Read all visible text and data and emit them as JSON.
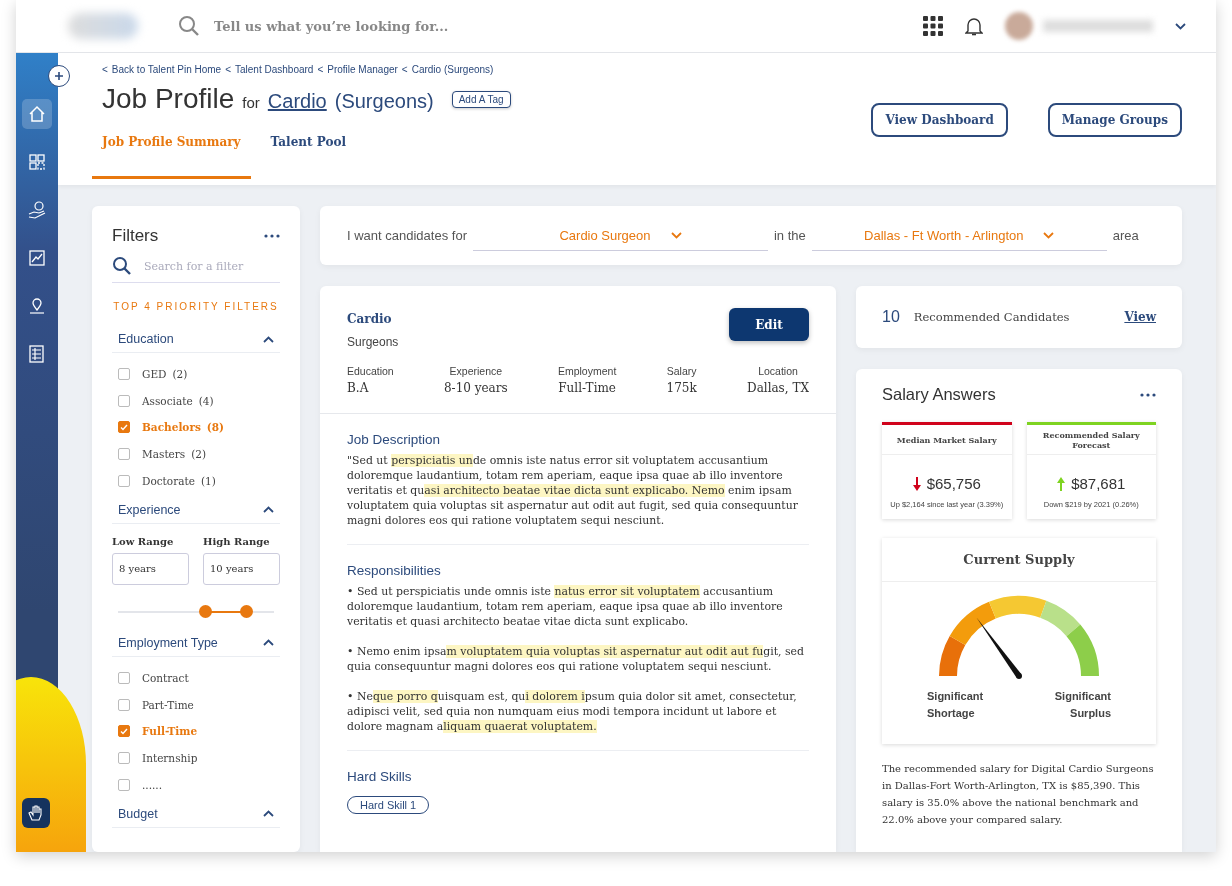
{
  "search": {
    "placeholder": "Tell us what you’re looking for..."
  },
  "sidebar": {
    "items": [
      {
        "selected": true
      },
      {
        "selected": false
      },
      {
        "selected": false
      },
      {
        "selected": false
      },
      {
        "selected": false
      },
      {
        "selected": false
      }
    ]
  },
  "breadcrumb": {
    "separator": "<",
    "items": [
      "Back to Talent Pin Home",
      "Talent Dashboard",
      "Profile Manager",
      "Cardio (Surgeons)"
    ]
  },
  "title": {
    "text": "Job Profile",
    "for": "for",
    "link": "Cardio",
    "suffix": "(Surgeons)",
    "tag_button": "Add A Tag"
  },
  "tabs": [
    {
      "label": "Job Profile Summary",
      "selected": true
    },
    {
      "label": "Talent Pool",
      "selected": false
    }
  ],
  "header_buttons": [
    "View Dashboard",
    "Manage Groups"
  ],
  "filters": {
    "title": "Filters",
    "search_placeholder": "Search for a filter",
    "priority_label": "TOP 4 PRIORITY FILTERS",
    "sections": [
      {
        "kind": "checklist",
        "title": "Education",
        "expanded": true,
        "options": [
          {
            "label": "GED",
            "count": "(2)",
            "checked": false
          },
          {
            "label": "Associate",
            "count": "(4)",
            "checked": false
          },
          {
            "label": "Bachelors",
            "count": "(8)",
            "checked": true
          },
          {
            "label": "Masters",
            "count": "(2)",
            "checked": false
          },
          {
            "label": "Doctorate",
            "count": "(1)",
            "checked": false
          }
        ]
      },
      {
        "kind": "range",
        "title": "Experience",
        "expanded": true,
        "low_label": "Low Range",
        "high_label": "High Range",
        "low_value": "8 years",
        "high_value": "10 years",
        "thumbs": [
          {
            "level": 0.56
          },
          {
            "level": 0.82
          }
        ]
      },
      {
        "kind": "checklist",
        "title": "Employment Type",
        "expanded": true,
        "options": [
          {
            "label": "Contract",
            "checked": false
          },
          {
            "label": "Part-Time",
            "checked": false
          },
          {
            "label": "Full-Time",
            "checked": true
          },
          {
            "label": "Internship",
            "checked": false
          },
          {
            "label": "......",
            "checked": false
          }
        ]
      },
      {
        "kind": "checklist",
        "title": "Budget",
        "expanded": true
      }
    ]
  },
  "query": {
    "prefix": "I want candidates for",
    "role": "Cardio Surgeon",
    "middle": "in the",
    "area": "Dallas - Ft Worth - Arlington",
    "suffix": "area"
  },
  "job": {
    "name": "Cardio",
    "subtitle": "Surgeons",
    "edit_button": "Edit",
    "stats": [
      {
        "label": "Education",
        "value": "B.A"
      },
      {
        "label": "Experience",
        "value": "8-10 years"
      },
      {
        "label": "Employment",
        "value": "Full-Time"
      },
      {
        "label": "Salary",
        "value": "175k"
      },
      {
        "label": "Location",
        "value": "Dallas, TX"
      }
    ],
    "sections": [
      {
        "kind": "text",
        "title": "Job Description",
        "paragraphs": [
          [
            {
              "text": "\"Sed ut ",
              "highlighted": false
            },
            {
              "text": "perspiciatis un",
              "highlighted": true
            },
            {
              "text": "de omnis iste natus error sit voluptatem accusantium doloremque laudantium, totam rem aperiam, eaque ipsa quae ab illo inventore veritatis et qu",
              "highlighted": false
            },
            {
              "text": "asi architecto beatae vitae dicta sunt explicabo. Nemo",
              "highlighted": true
            },
            {
              "text": " enim ipsam voluptatem quia voluptas sit aspernatur aut odit aut fugit, sed quia consequuntur magni dolores eos qui ratione voluptatem sequi nesciunt.",
              "highlighted": false
            }
          ]
        ]
      },
      {
        "kind": "text",
        "title": "Responsibilities",
        "paragraphs": [
          [
            {
              "text": "• Sed ut perspiciatis unde omnis iste ",
              "highlighted": false
            },
            {
              "text": "natus error sit voluptatem",
              "highlighted": true
            },
            {
              "text": " accusantium doloremque laudantium, totam rem aperiam, eaque ipsa quae ab illo inventore veritatis et quasi architecto beatae vitae dicta sunt explicabo.",
              "highlighted": false
            }
          ],
          [
            {
              "text": "• Nemo enim ipsa",
              "highlighted": false
            },
            {
              "text": "m voluptatem quia voluptas sit aspernatur aut odit aut fu",
              "highlighted": true
            },
            {
              "text": "git, sed quia consequuntur magni dolores eos qui ratione voluptatem sequi nesciunt.",
              "highlighted": false
            }
          ],
          [
            {
              "text": "• Ne",
              "highlighted": false
            },
            {
              "text": "que porro q",
              "highlighted": true
            },
            {
              "text": "uisquam est, qu",
              "highlighted": false
            },
            {
              "text": "i dolorem i",
              "highlighted": true
            },
            {
              "text": "psum quia dolor sit amet, consectetur, adipisci velit, sed quia non numquam eius modi tempora incidunt ut labore et dolore magnam a",
              "highlighted": false
            },
            {
              "text": "liquam quaerat voluptatem.",
              "highlighted": true
            }
          ]
        ]
      },
      {
        "kind": "skills",
        "title": "Hard Skills",
        "skills": [
          "Hard Skill 1"
        ]
      }
    ]
  },
  "candidates": {
    "count": "10",
    "label": "Recommended Candidates",
    "link": "View"
  },
  "salary": {
    "title": "Salary Answers",
    "cards": [
      {
        "title": "Median Market Salary",
        "color": "#d0021b",
        "kind": "down",
        "value": "$65,756",
        "note": "Up $2,164 since last year (3.39%)"
      },
      {
        "title": "Recommended Salary Forecast",
        "color": "#7ed321",
        "kind": "up",
        "value": "$87,681",
        "note": "Down $219 by 2021 (0.26%)"
      }
    ],
    "supply": {
      "title": "Current Supply",
      "level": 0.3,
      "low_label": "Significant Shortage",
      "high_label": "Significant Surplus"
    },
    "summary": "The recommended salary for Digital Cardio Surgeons in Dallas-Fort Worth-Arlington, TX is $85,390. This salary is 35.0% above the national benchmark and 22.0% above your compared salary."
  }
}
